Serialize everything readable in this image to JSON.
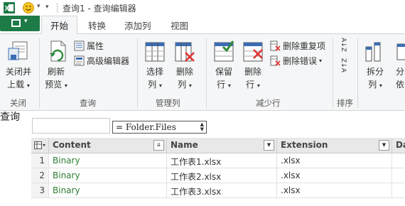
{
  "titlebar": {
    "title": "查询1 - 查询编辑器"
  },
  "tabs": [
    {
      "label": "开始",
      "active": true
    },
    {
      "label": "转换",
      "active": false
    },
    {
      "label": "添加列",
      "active": false
    },
    {
      "label": "视图",
      "active": false
    }
  ],
  "ribbon": {
    "close_group": {
      "label": "关闭",
      "close_load_line1": "关闭并",
      "close_load_line2": "上载"
    },
    "query_group": {
      "label": "查询",
      "refresh_line1": "刷新",
      "refresh_line2": "预览",
      "properties": "属性",
      "advanced_editor": "高级编辑器"
    },
    "manage_cols_group": {
      "label": "管理列",
      "choose_line1": "选择",
      "choose_line2": "列",
      "remove_line1": "删除",
      "remove_line2": "列"
    },
    "reduce_rows_group": {
      "label": "减少行",
      "keep_line1": "保留",
      "keep_line2": "行",
      "remove_line1": "删除",
      "remove_line2": "行",
      "remove_duplicates": "删除重复项",
      "remove_errors": "删除错误"
    },
    "sort_group": {
      "label": "排序",
      "sort_asc": "A↓Z",
      "sort_desc": "Z↓A"
    },
    "transform_group": {
      "split_line1": "拆分",
      "split_line2": "列",
      "group_line1": "分",
      "group_line2": "依"
    }
  },
  "query_label": "查询",
  "formula": {
    "text": "= Folder.Files"
  },
  "table": {
    "columns": [
      "Content",
      "Name",
      "Extension",
      "Dat"
    ],
    "rows": [
      {
        "num": "1",
        "content": "Binary",
        "name": "工作表1.xlsx",
        "ext": ".xlsx"
      },
      {
        "num": "2",
        "content": "Binary",
        "name": "工作表2.xlsx",
        "ext": ".xlsx"
      },
      {
        "num": "3",
        "content": "Binary",
        "name": "工作表3.xlsx",
        "ext": ".xlsx"
      }
    ]
  },
  "colors": {
    "file_tab": "#1e7a47",
    "binary_text": "#2f7d32",
    "ribbon_bg": "#f5f6f7"
  },
  "icons": [
    "excel-logo-icon",
    "smiley-icon",
    "undo-arrow-icon",
    "close-load-icon",
    "refresh-icon",
    "properties-icon",
    "advanced-editor-icon",
    "choose-columns-icon",
    "remove-columns-icon",
    "keep-rows-icon",
    "remove-rows-icon",
    "remove-duplicates-icon",
    "remove-errors-icon",
    "sort-asc-icon",
    "sort-desc-icon",
    "split-column-icon",
    "table-menu-icon",
    "filter-dropdown-icon"
  ]
}
